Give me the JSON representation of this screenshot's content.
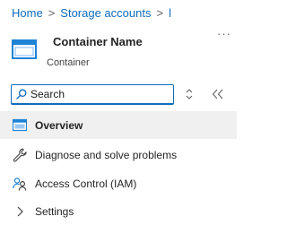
{
  "breadcrumb": {
    "home": "Home",
    "storage_accounts": "Storage accounts",
    "current": "l",
    "separator": ">"
  },
  "resource": {
    "name": "Container Name",
    "type": "Container",
    "more": "···",
    "icon": "container-icon"
  },
  "search": {
    "placeholder": "Search",
    "value": "",
    "icon": "search-icon"
  },
  "toolbar": {
    "sort_icon": "sort-updown-icon",
    "collapse_icon": "double-chevron-left-icon"
  },
  "nav": {
    "items": [
      {
        "label": "Overview",
        "icon": "overview-icon",
        "selected": true
      },
      {
        "label": "Diagnose and solve problems",
        "icon": "wrench-icon",
        "selected": false
      },
      {
        "label": "Access Control (IAM)",
        "icon": "people-icon",
        "selected": false
      },
      {
        "label": "Settings",
        "icon": "chevron-right-icon",
        "selected": false
      }
    ]
  },
  "colors": {
    "accent": "#0f6cbd",
    "selected_bg": "#f0f0f0",
    "icon_blue": "#1f84d6"
  }
}
